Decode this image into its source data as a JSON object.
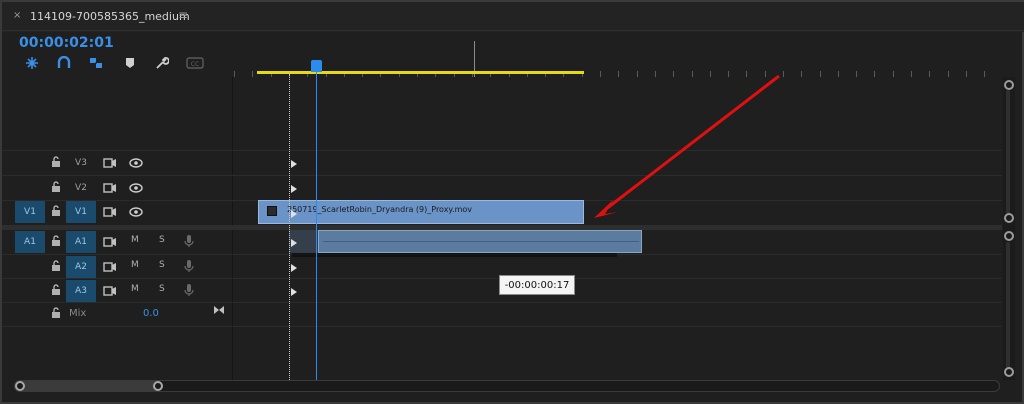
{
  "panel": {
    "close_glyph": "×",
    "title": "114109-700585365_medium",
    "menu_glyph": "≡",
    "timecode": "00:00:02:01"
  },
  "toolbar": {
    "tools": [
      "snap-icon",
      "magnet-link-icon",
      "linked-selection-icon",
      "marker-icon",
      "wrench-icon",
      "captions-icon"
    ]
  },
  "tracks": {
    "video": [
      {
        "name": "V3",
        "source": "",
        "active": false
      },
      {
        "name": "V2",
        "source": "",
        "active": false
      },
      {
        "name": "V1",
        "source": "V1",
        "active": true
      }
    ],
    "audio": [
      {
        "name": "A1",
        "source": "A1",
        "active": true,
        "mute": "M",
        "solo": "S"
      },
      {
        "name": "A2",
        "source": "",
        "active": true,
        "mute": "M",
        "solo": "S"
      },
      {
        "name": "A3",
        "source": "",
        "active": true,
        "mute": "M",
        "solo": "S"
      }
    ],
    "mix": {
      "label": "Mix",
      "value": "0.0"
    }
  },
  "clips": {
    "video_clip_name": "250719_ScarletRobin_Dryandra (9)_Proxy.mov"
  },
  "tooltip": {
    "text": "-00:00:00:17"
  },
  "colors": {
    "accent_blue": "#2d8ceb",
    "work_area_yellow": "#e8d915",
    "annotation_red": "#e01010",
    "video_clip": "#6a93c8",
    "audio_clip": "#5c7c9f"
  }
}
